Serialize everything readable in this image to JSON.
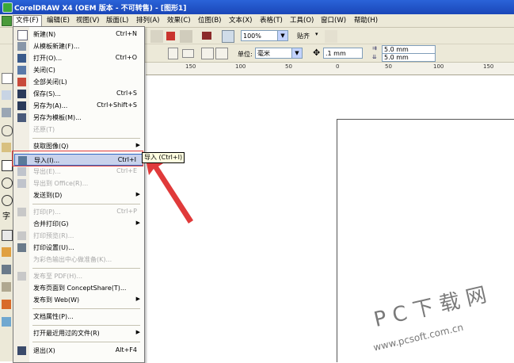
{
  "window": {
    "title": "CorelDRAW X4 (OEM 版本 - 不可转售) - [图形1]"
  },
  "menubar": {
    "items": [
      {
        "label": "文件(F)",
        "active": true
      },
      {
        "label": "编辑(E)"
      },
      {
        "label": "视图(V)"
      },
      {
        "label": "版面(L)"
      },
      {
        "label": "排列(A)"
      },
      {
        "label": "效果(C)"
      },
      {
        "label": "位图(B)"
      },
      {
        "label": "文本(X)"
      },
      {
        "label": "表格(T)"
      },
      {
        "label": "工具(O)"
      },
      {
        "label": "窗口(W)"
      },
      {
        "label": "帮助(H)"
      }
    ]
  },
  "toolbar": {
    "zoom_value": "100%",
    "snap_label": "贴齐"
  },
  "propbar": {
    "units_label": "单位:",
    "units_value": "毫米",
    "nudge_value": ".1 mm",
    "dup_x": "5.0 mm",
    "dup_y": "5.0 mm"
  },
  "ruler": {
    "ticks": [
      "150",
      "100",
      "50",
      "0",
      "50",
      "100",
      "150"
    ]
  },
  "file_menu": {
    "items": [
      {
        "label": "新建(N)",
        "shortcut": "Ctrl+N",
        "icon": "new-doc-icon"
      },
      {
        "label": "从模板新建(F)...",
        "shortcut": "",
        "icon": "template-icon"
      },
      {
        "label": "打开(O)...",
        "shortcut": "Ctrl+O",
        "icon": "open-folder-icon"
      },
      {
        "label": "关闭(C)",
        "shortcut": "",
        "icon": "close-doc-icon"
      },
      {
        "label": "全部关闭(L)",
        "shortcut": "",
        "icon": "close-all-icon"
      },
      {
        "label": "保存(S)...",
        "shortcut": "Ctrl+S",
        "icon": "save-icon"
      },
      {
        "label": "另存为(A)...",
        "shortcut": "Ctrl+Shift+S",
        "icon": "save-as-icon"
      },
      {
        "label": "另存为模板(M)...",
        "shortcut": "",
        "icon": "save-template-icon"
      },
      {
        "label": "还原(T)",
        "shortcut": "",
        "disabled": true
      },
      {
        "label": "获取图像(Q)",
        "submenu": true
      },
      {
        "label": "导入(I)...",
        "shortcut": "Ctrl+I",
        "icon": "import-icon",
        "highlighted": true
      },
      {
        "label": "导出(E)...",
        "shortcut": "Ctrl+E",
        "icon": "export-icon",
        "disabled": true
      },
      {
        "label": "导出到 Office(R)...",
        "shortcut": "",
        "icon": "export-office-icon",
        "disabled": true
      },
      {
        "label": "发送到(D)",
        "submenu": true
      },
      {
        "label": "打印(P)...",
        "shortcut": "Ctrl+P",
        "icon": "print-icon",
        "disabled": true
      },
      {
        "label": "合并打印(G)",
        "submenu": true
      },
      {
        "label": "打印预览(R)...",
        "shortcut": "",
        "icon": "print-preview-icon",
        "disabled": true
      },
      {
        "label": "打印设置(U)...",
        "shortcut": "",
        "icon": "print-setup-icon"
      },
      {
        "label": "为彩色输出中心做准备(K)...",
        "shortcut": "",
        "disabled": true
      },
      {
        "label": "发布至 PDF(H)...",
        "shortcut": "",
        "icon": "pdf-icon",
        "disabled": true
      },
      {
        "label": "发布页面到 ConceptShare(T)...",
        "shortcut": ""
      },
      {
        "label": "发布到 Web(W)",
        "submenu": true
      },
      {
        "label": "文档属性(P)...",
        "shortcut": ""
      },
      {
        "label": "打开最近用过的文件(R)",
        "submenu": true
      },
      {
        "label": "退出(X)",
        "shortcut": "Alt+F4",
        "icon": "exit-icon"
      }
    ]
  },
  "tooltip": "导入 (Ctrl+I)",
  "watermark": {
    "line1": "P C 下 载 网",
    "line2": "www.pcsoft.com.cn"
  }
}
